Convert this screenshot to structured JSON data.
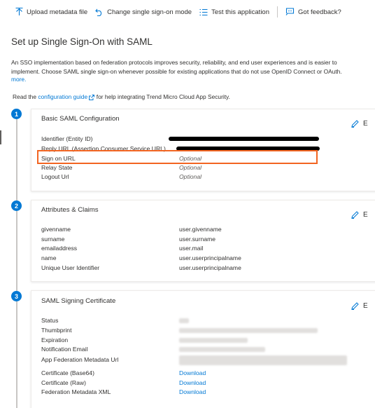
{
  "toolbar": {
    "upload": "Upload metadata file",
    "change": "Change single sign-on mode",
    "test": "Test this application",
    "feedback": "Got feedback?"
  },
  "page": {
    "title": "Set up Single Sign-On with SAML",
    "desc_line1": "An SSO implementation based on federation protocols improves security, reliability, and end user experiences and is easier to",
    "desc_line2": "implement. Choose SAML single sign-on whenever possible for existing applications that do not use OpenID Connect or OAuth.",
    "more": "more.",
    "read_prefix": "Read the ",
    "read_link": "configuration guide",
    "read_suffix": " for help integrating Trend Micro Cloud App Security."
  },
  "sections": {
    "s1": {
      "step": "1",
      "title": "Basic SAML Configuration",
      "edit": "E",
      "rows": [
        {
          "label": "Identifier (Entity ID)",
          "value": ""
        },
        {
          "label": "Reply URL (Assertion Consumer Service URL)",
          "value": ""
        },
        {
          "label": "Sign on URL",
          "value": "Optional"
        },
        {
          "label": "Relay State",
          "value": "Optional"
        },
        {
          "label": "Logout Url",
          "value": "Optional"
        }
      ]
    },
    "s2": {
      "step": "2",
      "title": "Attributes & Claims",
      "edit": "E",
      "rows": [
        {
          "label": "givenname",
          "value": "user.givenname"
        },
        {
          "label": "surname",
          "value": "user.surname"
        },
        {
          "label": "emailaddress",
          "value": "user.mail"
        },
        {
          "label": "name",
          "value": "user.userprincipalname"
        },
        {
          "label": "Unique User Identifier",
          "value": "user.userprincipalname"
        }
      ]
    },
    "s3": {
      "step": "3",
      "title": "SAML Signing Certificate",
      "edit": "E",
      "rows": [
        {
          "label": "Status",
          "value": ""
        },
        {
          "label": "Thumbprint",
          "value": ""
        },
        {
          "label": "Expiration",
          "value": ""
        },
        {
          "label": "Notification Email",
          "value": ""
        },
        {
          "label": "App Federation Metadata Url",
          "value": ""
        },
        {
          "label": "Certificate (Base64)",
          "value": "Download"
        },
        {
          "label": "Certificate (Raw)",
          "value": "Download"
        },
        {
          "label": "Federation Metadata XML",
          "value": "Download"
        }
      ]
    }
  },
  "colors": {
    "accent": "#0078d4",
    "highlight": "#f26522",
    "text": "#323130"
  }
}
